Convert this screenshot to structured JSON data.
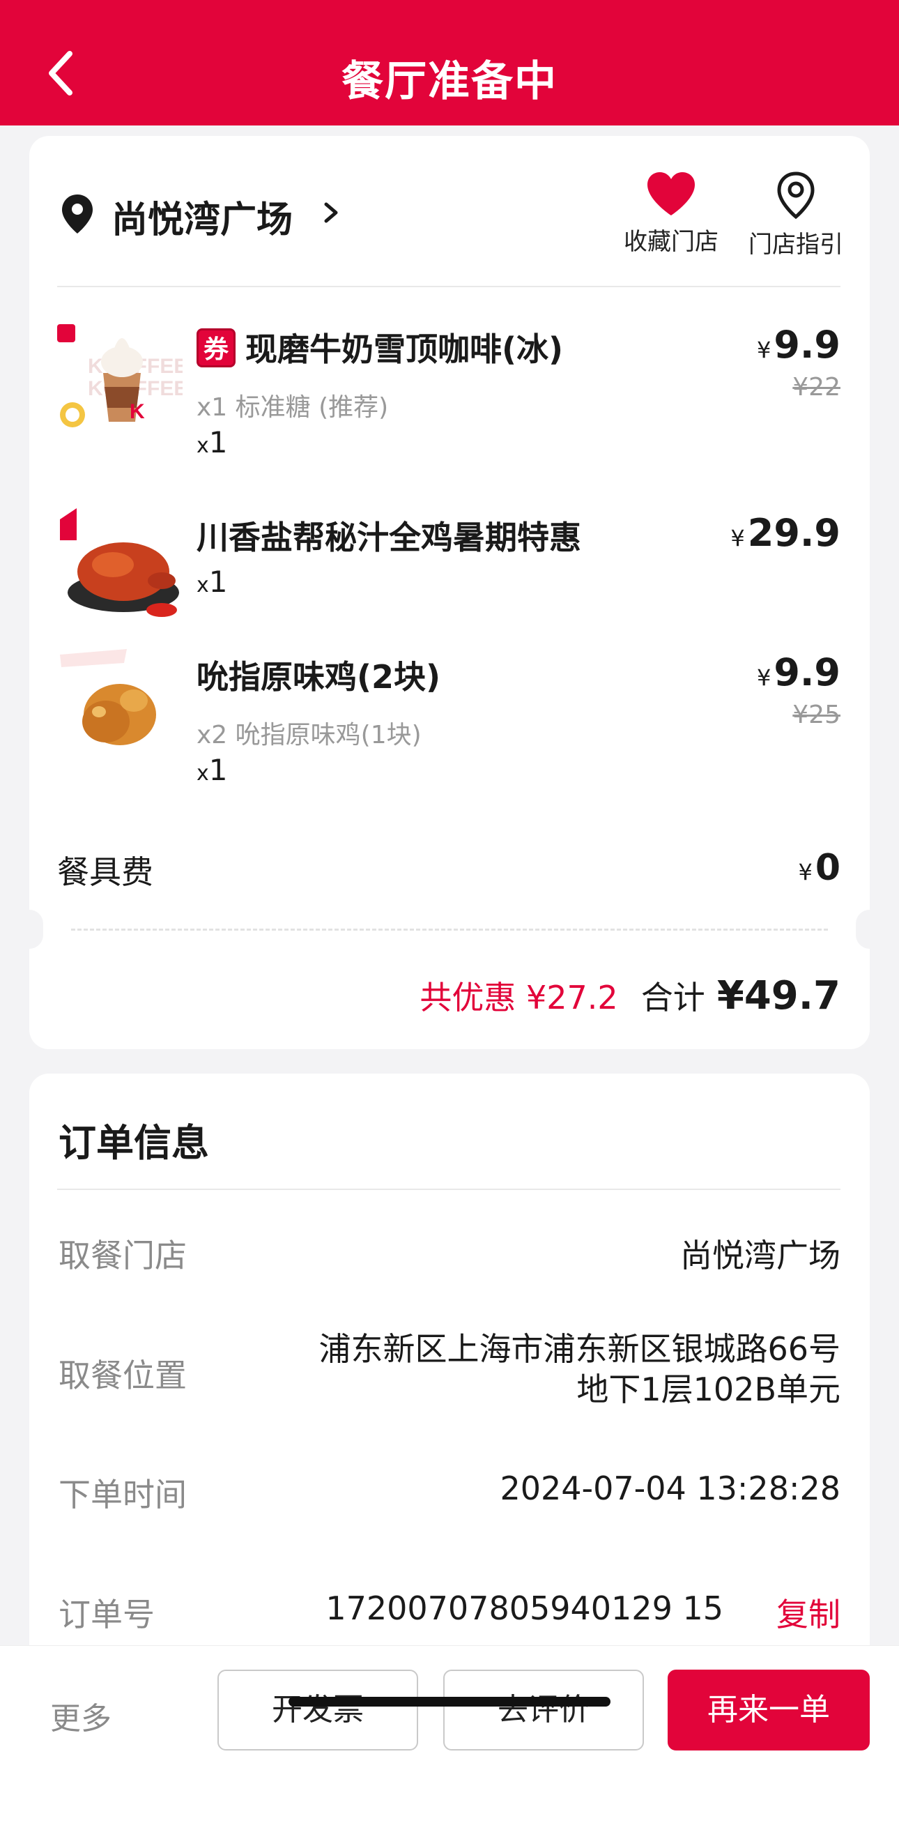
{
  "header": {
    "title": "餐厅准备中"
  },
  "store": {
    "name": "尚悦湾广场",
    "favorite_label": "收藏门店",
    "guide_label": "门店指引"
  },
  "items": [
    {
      "badge": "券",
      "name": "现磨牛奶雪顶咖啡(冰)",
      "spec": "x1 标准糖 (推荐)",
      "qty_prefix": "x",
      "qty": "1",
      "currency": "¥",
      "price": "9.9",
      "original_price": "¥22"
    },
    {
      "name": "川香盐帮秘汁全鸡暑期特惠",
      "qty_prefix": "x",
      "qty": "1",
      "currency": "¥",
      "price": "29.9"
    },
    {
      "name": "吮指原味鸡(2块)",
      "spec": "x2 吮指原味鸡(1块)",
      "qty_prefix": "x",
      "qty": "1",
      "currency": "¥",
      "price": "9.9",
      "original_price": "¥25"
    }
  ],
  "fee": {
    "label": "餐具费",
    "currency": "¥",
    "value": "0"
  },
  "summary": {
    "discount": "共优惠 ¥27.2",
    "total_label": "合计",
    "total_value": "¥49.7"
  },
  "order_info": {
    "title": "订单信息",
    "rows": [
      {
        "label": "取餐门店",
        "value": "尚悦湾广场"
      },
      {
        "label": "取餐位置",
        "value": "浦东新区上海市浦东新区银城路66号地下1层102B单元"
      },
      {
        "label": "下单时间",
        "value": "2024-07-04 13:28:28"
      },
      {
        "label": "订单号",
        "value": "17200707805940129 15",
        "action": "复制"
      }
    ]
  },
  "bottom_bar": {
    "more": "更多",
    "invoice": "开发票",
    "review": "去评价",
    "reorder": "再来一单"
  },
  "colors": {
    "brand": "#e2043a",
    "background": "#f3f3f5"
  }
}
